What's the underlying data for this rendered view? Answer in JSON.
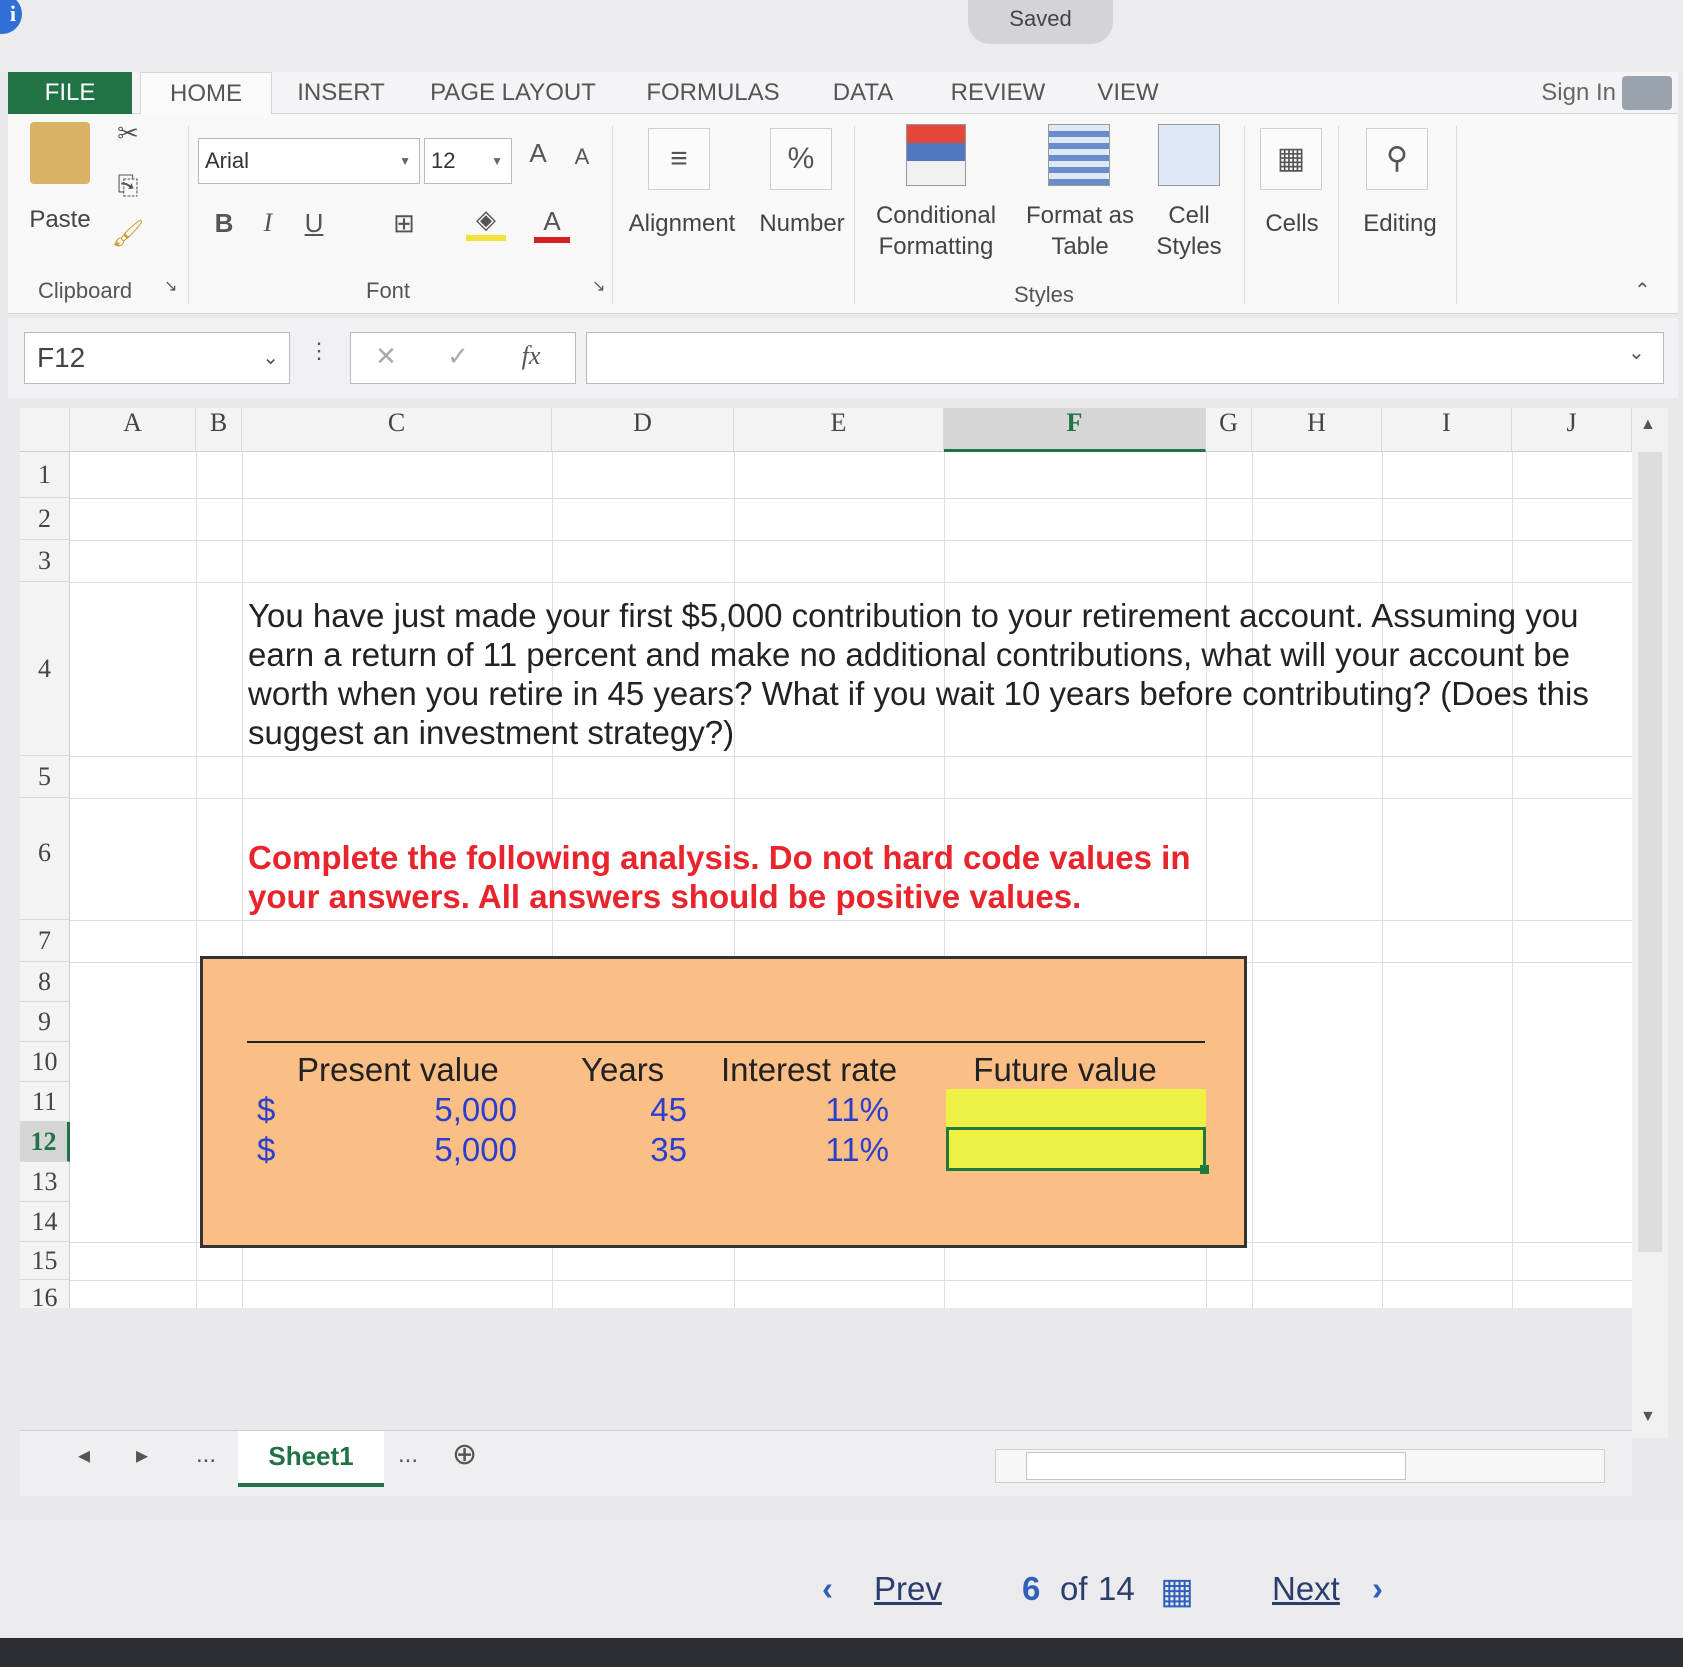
{
  "status": {
    "saved": "Saved"
  },
  "tabs": [
    "FILE",
    "HOME",
    "INSERT",
    "PAGE LAYOUT",
    "FORMULAS",
    "DATA",
    "REVIEW",
    "VIEW"
  ],
  "sign_in": "Sign In",
  "ribbon": {
    "clipboard": {
      "paste": "Paste",
      "label": "Clipboard"
    },
    "font": {
      "name": "Arial",
      "size": "12",
      "label": "Font",
      "bold": "B",
      "italic": "I",
      "underline": "U",
      "grow": "A",
      "shrink": "A",
      "color_a": "A"
    },
    "alignment": "Alignment",
    "number": "Number",
    "number_symbol": "%",
    "styles": {
      "conditional_1": "Conditional",
      "conditional_2": "Formatting",
      "format_table_1": "Format as",
      "format_table_2": "Table",
      "cell_styles_1": "Cell",
      "cell_styles_2": "Styles",
      "label": "Styles"
    },
    "cells": "Cells",
    "editing": "Editing"
  },
  "formula_bar": {
    "name_box": "F12",
    "fx": "fx",
    "formula": ""
  },
  "columns": [
    "A",
    "B",
    "C",
    "D",
    "E",
    "F",
    "G",
    "H",
    "I",
    "J"
  ],
  "rows": [
    "1",
    "2",
    "3",
    "4",
    "5",
    "6",
    "7",
    "8",
    "9",
    "10",
    "11",
    "12",
    "13",
    "14",
    "15",
    "16"
  ],
  "question": "You have just made your first $5,000 contribution to your retirement account. Assuming you earn a return of 11 percent and make no additional contributions, what will your account be worth when you retire in 45 years? What if you wait 10 years before contributing? (Does this suggest an investment strategy?)",
  "instruction": "Complete the following analysis. Do not hard code values in your answers. All answers should be positive values.",
  "table": {
    "headers": {
      "pv": "Present value",
      "years": "Years",
      "rate": "Interest rate",
      "fv": "Future value"
    },
    "rows": [
      {
        "currency": "$",
        "pv": "5,000",
        "years": "45",
        "rate": "11%",
        "fv": ""
      },
      {
        "currency": "$",
        "pv": "5,000",
        "years": "35",
        "rate": "11%",
        "fv": ""
      }
    ]
  },
  "sheet_tabs": {
    "ellipsis_left": "...",
    "active": "Sheet1",
    "ellipsis_right": "..."
  },
  "navigation": {
    "prev": "Prev",
    "current": "6",
    "of": "of",
    "total": "14",
    "next": "Next"
  },
  "colors": {
    "excel_green": "#217346",
    "orange_fill": "#fbbe85",
    "answer_yellow": "#eef044",
    "instruction_red": "#e8242c",
    "value_blue": "#2b3fcf"
  }
}
